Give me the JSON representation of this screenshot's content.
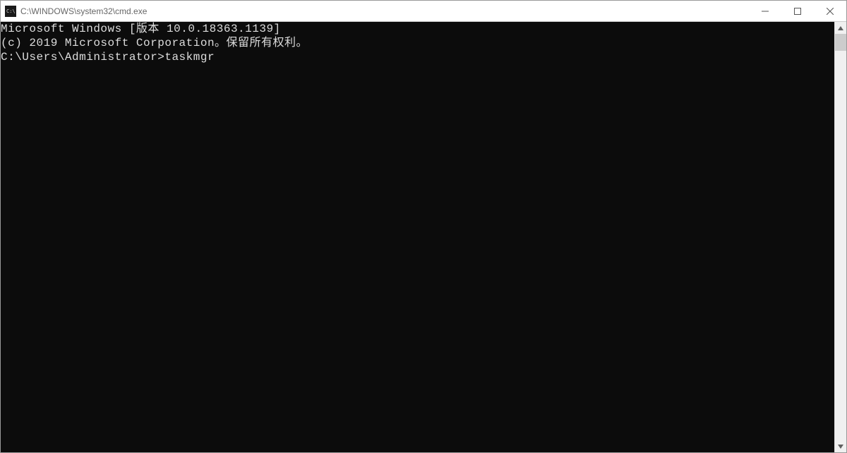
{
  "window": {
    "title": "C:\\WINDOWS\\system32\\cmd.exe"
  },
  "terminal": {
    "line1": "Microsoft Windows [版本 10.0.18363.1139]",
    "line2": "(c) 2019 Microsoft Corporation。保留所有权利。",
    "line3_blank": "",
    "prompt": "C:\\Users\\Administrator>",
    "command": "taskmgr"
  }
}
